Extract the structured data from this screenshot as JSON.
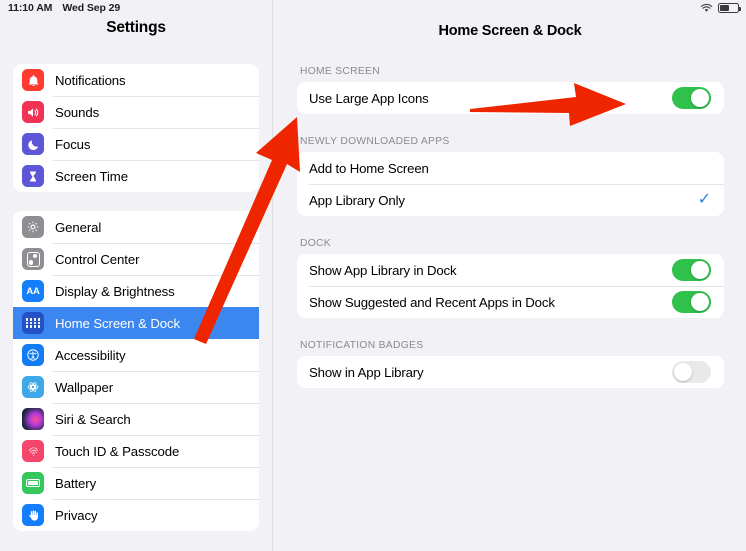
{
  "status_bar": {
    "time": "11:10 AM",
    "date": "Wed Sep 29",
    "wifi_icon": "wifi-icon",
    "battery_icon": "battery-icon"
  },
  "sidebar": {
    "title": "Settings",
    "selected_item": "Home Screen & Dock",
    "selected_color": "#3b86ef",
    "groups": [
      {
        "items": [
          {
            "label": "Notifications",
            "icon": "bell-icon",
            "icon_color": "#ff3b30"
          },
          {
            "label": "Sounds",
            "icon": "speaker-icon",
            "icon_color": "#f03355"
          },
          {
            "label": "Focus",
            "icon": "moon-icon",
            "icon_color": "#5d56d6"
          },
          {
            "label": "Screen Time",
            "icon": "hourglass-icon",
            "icon_color": "#5d56d6"
          }
        ]
      },
      {
        "items": [
          {
            "label": "General",
            "icon": "gear-icon",
            "icon_color": "#8e8e93"
          },
          {
            "label": "Control Center",
            "icon": "sliders-icon",
            "icon_color": "#8e8e93"
          },
          {
            "label": "Display & Brightness",
            "icon": "aa-text-icon",
            "icon_color": "#147efb"
          },
          {
            "label": "Home Screen & Dock",
            "icon": "app-grid-icon",
            "icon_color": "#2451c4"
          },
          {
            "label": "Accessibility",
            "icon": "accessibility-person-icon",
            "icon_color": "#127cf4"
          },
          {
            "label": "Wallpaper",
            "icon": "flower-icon",
            "icon_color": "#3fa8e8"
          },
          {
            "label": "Siri & Search",
            "icon": "siri-orb-icon",
            "icon_color": "#b03ad8"
          },
          {
            "label": "Touch ID & Passcode",
            "icon": "fingerprint-icon",
            "icon_color": "#f4456a"
          },
          {
            "label": "Battery",
            "icon": "battery-icon",
            "icon_color": "#34c759"
          },
          {
            "label": "Privacy",
            "icon": "hand-icon",
            "icon_color": "#147efb"
          }
        ]
      }
    ]
  },
  "detail": {
    "title": "Home Screen & Dock",
    "sections": [
      {
        "header": "HOME SCREEN",
        "rows": [
          {
            "label": "Use Large App Icons",
            "control": "toggle",
            "value": "on"
          }
        ]
      },
      {
        "header": "NEWLY DOWNLOADED APPS",
        "rows": [
          {
            "label": "Add to Home Screen",
            "control": "none",
            "value": ""
          },
          {
            "label": "App Library Only",
            "control": "check",
            "value": "checked"
          }
        ]
      },
      {
        "header": "DOCK",
        "rows": [
          {
            "label": "Show App Library in Dock",
            "control": "toggle",
            "value": "on"
          },
          {
            "label": "Show Suggested and Recent Apps in Dock",
            "control": "toggle",
            "value": "on"
          }
        ]
      },
      {
        "header": "NOTIFICATION BADGES",
        "rows": [
          {
            "label": "Show in App Library",
            "control": "toggle",
            "value": "off"
          }
        ]
      }
    ]
  },
  "annotations": {
    "color": "#ef2500",
    "arrows": [
      {
        "name": "arrow-to-large-app-icons-toggle",
        "direction": "right"
      },
      {
        "name": "arrow-to-home-screen-and-dock-item",
        "direction": "up-right"
      }
    ]
  }
}
